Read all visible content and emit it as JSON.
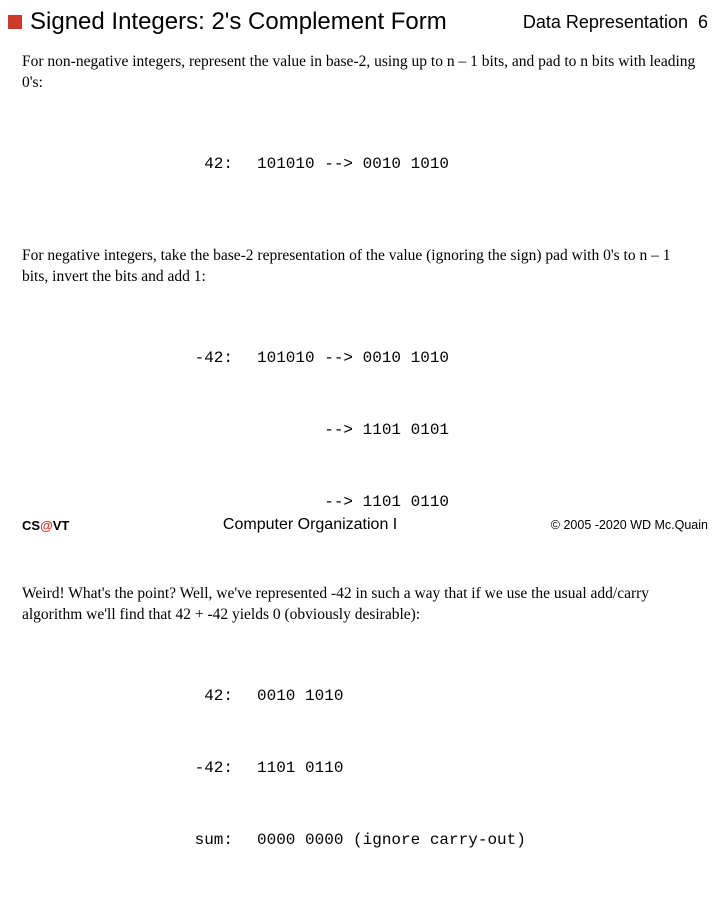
{
  "header": {
    "title": "Signed Integers: 2's Complement Form",
    "chapter": "Data Representation",
    "page": "6"
  },
  "section1": {
    "text": "For non-negative integers, represent the value in base-2, using up to n – 1 bits, and pad to n bits with leading 0's:",
    "rows": [
      {
        "label": "42:",
        "value": "101010 --> 0010 1010"
      }
    ]
  },
  "section2": {
    "text": "For negative integers, take the base-2 representation of the value (ignoring the sign) pad with 0's to n – 1 bits, invert the bits and add 1:",
    "rows": [
      {
        "label": "-42:",
        "value": "101010 --> 0010 1010"
      },
      {
        "label": "",
        "value": "       --> 1101 0101"
      },
      {
        "label": "",
        "value": "       --> 1101 0110"
      }
    ]
  },
  "section3": {
    "text": "Weird!  What's the point?  Well, we've represented -42 in such a way that if we use the usual add/carry algorithm we'll find that 42 + -42 yields 0 (obviously desirable):",
    "rows": [
      {
        "label": "42:",
        "value": "0010 1010"
      },
      {
        "label": "-42:",
        "value": "1101 0110"
      },
      {
        "label": "sum:",
        "value": "0000 0000 (ignore carry-out)"
      }
    ]
  },
  "footer": {
    "left_cs": "CS",
    "left_at": "@",
    "left_vt": "VT",
    "center": "Computer Organization I",
    "right": "© 2005 -2020  WD Mc.Quain"
  }
}
